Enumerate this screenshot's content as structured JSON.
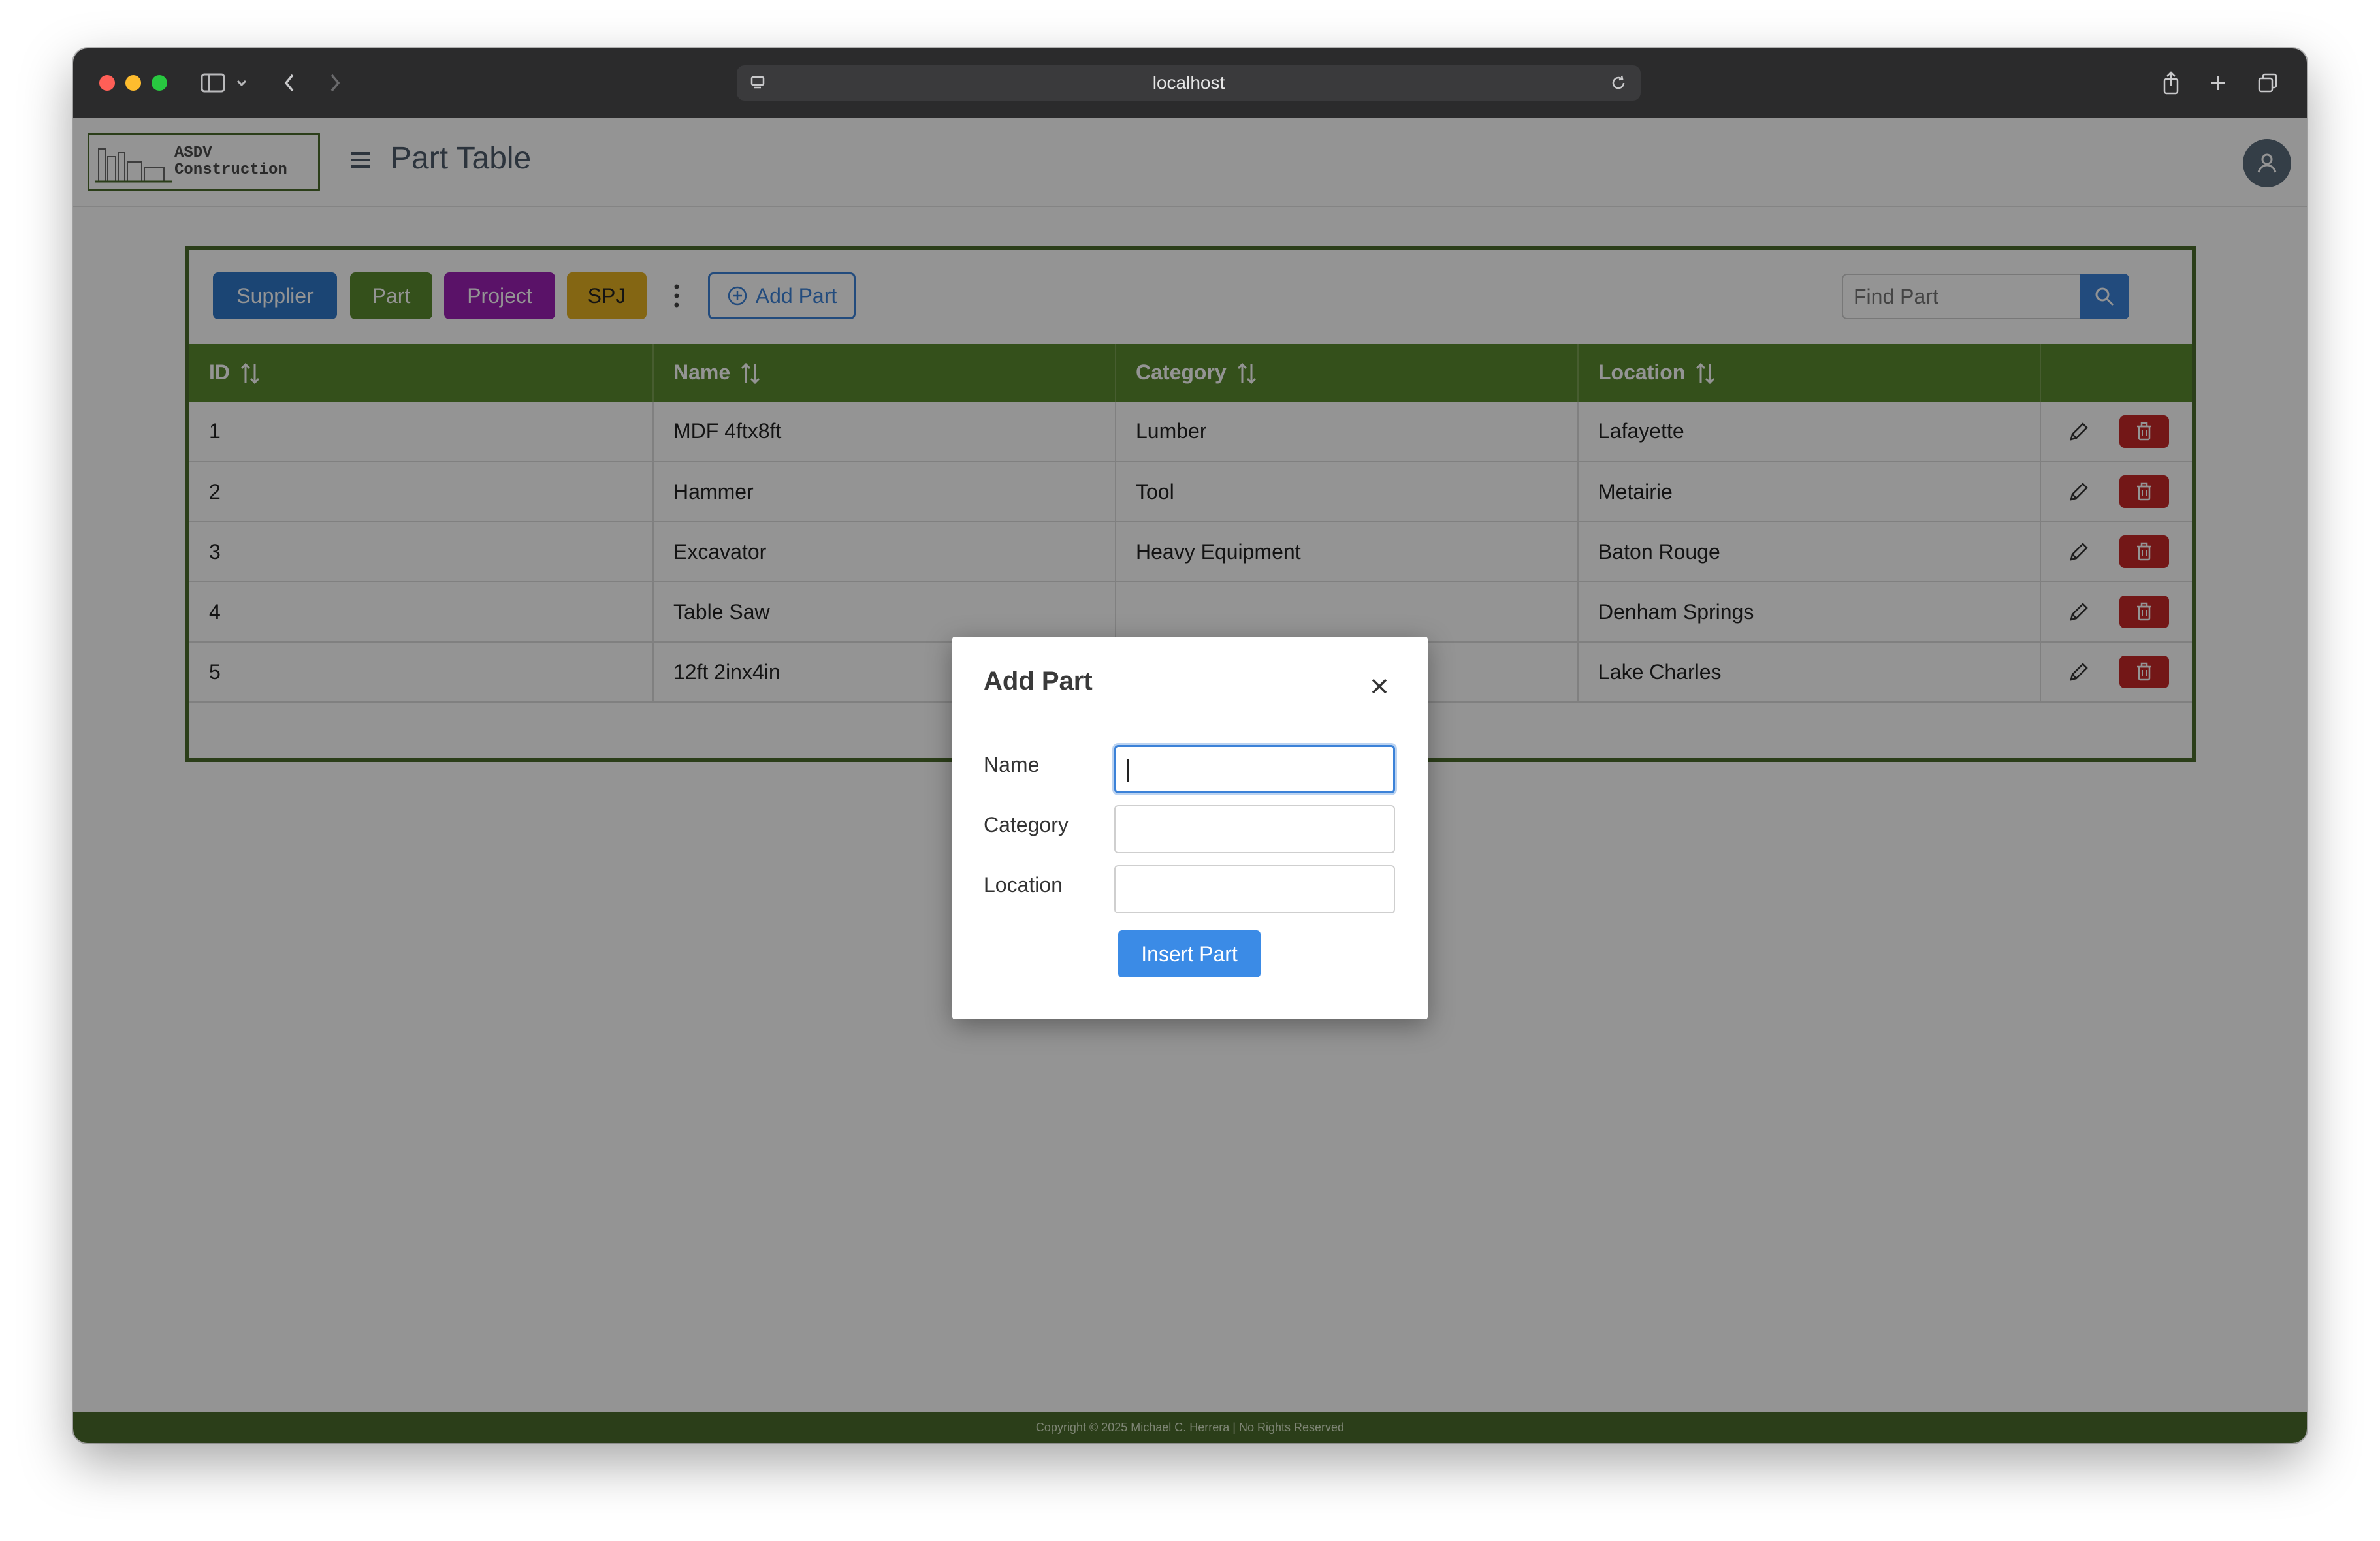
{
  "browser": {
    "url": "localhost"
  },
  "header": {
    "logo_line1": "ASDV",
    "logo_line2": "Construction",
    "title": "Part Table"
  },
  "toolbar": {
    "supplier_label": "Supplier",
    "part_label": "Part",
    "project_label": "Project",
    "spj_label": "SPJ",
    "add_part_label": "Add Part",
    "search_placeholder": "Find Part"
  },
  "table": {
    "columns": [
      "ID",
      "Name",
      "Category",
      "Location"
    ],
    "rows": [
      {
        "id": "1",
        "name": "MDF 4ftx8ft",
        "category": "Lumber",
        "location": "Lafayette"
      },
      {
        "id": "2",
        "name": "Hammer",
        "category": "Tool",
        "location": "Metairie"
      },
      {
        "id": "3",
        "name": "Excavator",
        "category": "Heavy Equipment",
        "location": "Baton Rouge"
      },
      {
        "id": "4",
        "name": "Table Saw",
        "category": "",
        "location": "Denham Springs"
      },
      {
        "id": "5",
        "name": "12ft 2inx4in",
        "category": "",
        "location": "Lake Charles"
      }
    ]
  },
  "modal": {
    "title": "Add Part",
    "name_label": "Name",
    "category_label": "Category",
    "location_label": "Location",
    "name_value": "",
    "category_value": "",
    "location_value": "",
    "submit_label": "Insert Part"
  },
  "footer": {
    "text": "Copyright © 2025 Michael C. Herrera  |  No Rights Reserved"
  },
  "colors": {
    "supplier": "#2f77c9",
    "part": "#5a8a2f",
    "project": "#9b1fb3",
    "spj": "#e3b021",
    "header_green": "#5a8a2f",
    "border_green": "#4b6b2c",
    "primary_blue": "#3b82d8",
    "danger_red": "#c62828"
  },
  "icons": {
    "sort": "sort-arrows-icon",
    "edit": "pencil-icon",
    "delete": "trash-icon",
    "search": "search-icon",
    "close": "close-icon",
    "add": "plus-circle-icon",
    "menu": "hamburger-icon",
    "avatar": "user-icon"
  }
}
